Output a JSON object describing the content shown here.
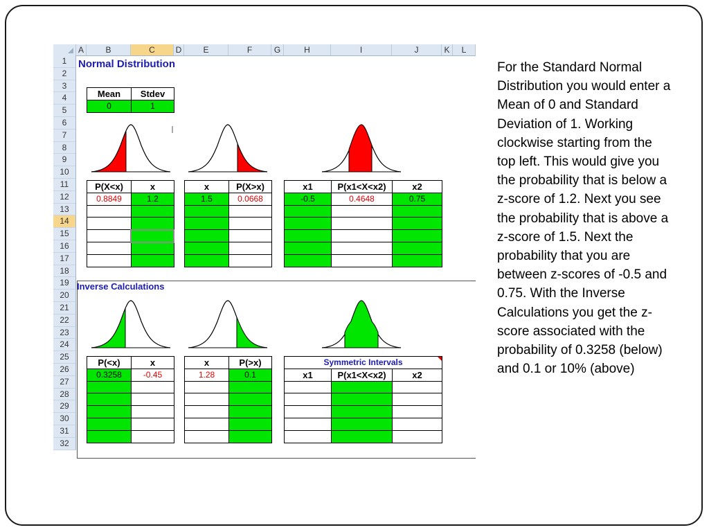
{
  "columns": [
    "A",
    "B",
    "C",
    "D",
    "E",
    "F",
    "G",
    "H",
    "I",
    "J",
    "K",
    "L"
  ],
  "selected_column": "C",
  "rows": [
    "1",
    "2",
    "3",
    "4",
    "5",
    "6",
    "7",
    "8",
    "9",
    "10",
    "11",
    "12",
    "13",
    "14",
    "15",
    "16",
    "17",
    "18",
    "19",
    "20",
    "21",
    "22",
    "23",
    "24",
    "25",
    "26",
    "27",
    "28",
    "29",
    "30",
    "31",
    "32"
  ],
  "selected_row": "14",
  "normal_title": "Normal Distribution",
  "inverse_title": "Inverse Calculations",
  "params": {
    "mean_label": "Mean",
    "stdev_label": "Stdev",
    "mean": "0",
    "stdev": "1"
  },
  "left_tail": {
    "p_label": "P(X<x)",
    "x_label": "x",
    "p": "0.8849",
    "x": "1.2"
  },
  "right_tail": {
    "x_label": "x",
    "p_label": "P(X>x)",
    "x": "1.5",
    "p": "0.0668"
  },
  "between": {
    "x1_label": "x1",
    "p_label": "P(x1<X<x2)",
    "x2_label": "x2",
    "x1": "-0.5",
    "p": "0.4648",
    "x2": "0.75"
  },
  "inv_left": {
    "p_label": "P(<x)",
    "x_label": "x",
    "p": "0.3258",
    "x": "-0.45"
  },
  "inv_right": {
    "x_label": "x",
    "p_label": "P(>x)",
    "x": "1.28",
    "p": "0.1"
  },
  "symmetric": {
    "title": "Symmetric Intervals",
    "x1_label": "x1",
    "p_label": "P(x1<X<x2)",
    "x2_label": "x2"
  },
  "colors": {
    "fill_red": "#ff0000",
    "fill_green": "#00e600",
    "title_blue": "#1c1cb4"
  },
  "description": "For the Standard Normal Distribution you would enter a Mean of 0 and Standard Deviation of 1.  Working clockwise starting from the top left.  This would give you the probability that is below a z-score of 1.2.  Next you see the probability that is above a z-score of 1.5.  Next the probability that you are between z-scores of -0.5 and 0.75.  With the Inverse Calculations you get the z-score associated with the probability of 0.3258 (below) and 0.1 or 10% (above)"
}
